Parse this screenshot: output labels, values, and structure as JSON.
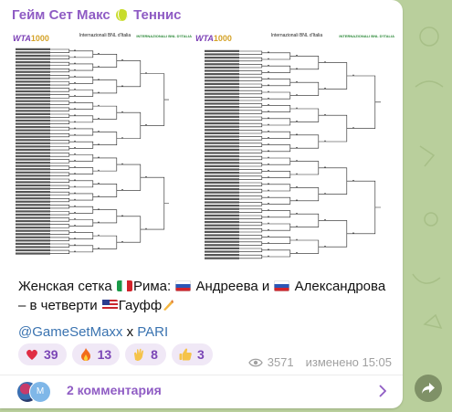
{
  "channel": {
    "name_part1": "Гейм Сет Макс",
    "name_part2": "Теннис"
  },
  "media": {
    "left_sheet": {
      "brand": "WTA",
      "brand_tier": "1000",
      "title": "Internazionali BNL d'Italia",
      "logo": "INTERNAZIONALI BNL D'ITALIA"
    },
    "right_sheet": {
      "brand": "WTA",
      "brand_tier": "1000",
      "title": "Internazionali BNL d'Italia",
      "logo": "INTERNAZIONALI BNL D'ITALIA"
    }
  },
  "post": {
    "line1_a": "Женская сетка",
    "line1_b": "Рима:",
    "line1_c": "Андреева и",
    "line1_d": "Александрова – в",
    "line2_a": "четверти",
    "line2_b": "Гауфф",
    "mention": "@GameSetMaxx",
    "x": "x",
    "partner": "PARI"
  },
  "reactions": [
    {
      "icon": "heart-icon",
      "count": "39"
    },
    {
      "icon": "fire-icon",
      "count": "13"
    },
    {
      "icon": "clap-icon",
      "count": "8"
    },
    {
      "icon": "thumbs-up-icon",
      "count": "3"
    }
  ],
  "meta": {
    "views": "3571",
    "edited": "изменено 15:05"
  },
  "comments": {
    "avatar2_initial": "M",
    "label": "2 комментария"
  },
  "colors": {
    "accent": "#8f5cc4",
    "link": "#3a73b0",
    "background": "#b9cf9c"
  }
}
